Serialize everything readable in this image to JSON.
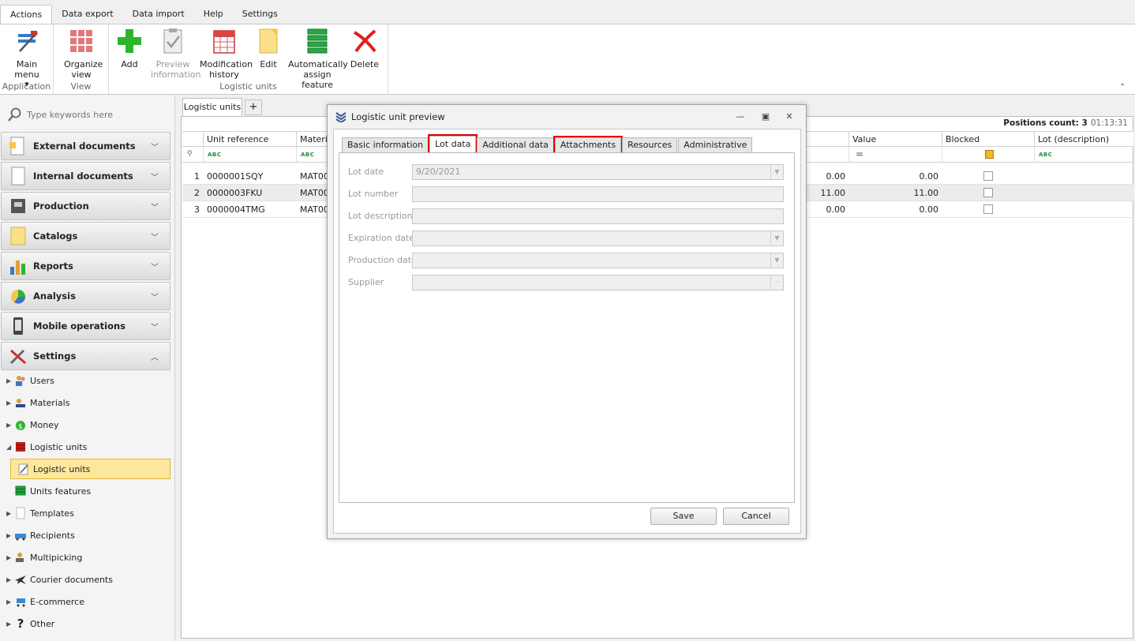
{
  "ribbon": {
    "tabs": [
      "Actions",
      "Data export",
      "Data import",
      "Help",
      "Settings"
    ],
    "groups": {
      "application": "Application",
      "view": "View",
      "logistic_units": "Logistic units"
    },
    "buttons": {
      "main_menu": "Main menu",
      "organize_view": "Organize view",
      "add": "Add",
      "preview_information": "Preview information",
      "modification_history": "Modification history",
      "edit": "Edit",
      "auto_assign": "Automatically assign feature",
      "delete": "Delete"
    }
  },
  "sidebar": {
    "search_placeholder": "Type keywords here",
    "sections": [
      "External documents",
      "Internal documents",
      "Production",
      "Catalogs",
      "Reports",
      "Analysis",
      "Mobile operations",
      "Settings"
    ],
    "settings_items": {
      "users": "Users",
      "materials": "Materials",
      "money": "Money",
      "logistic_units": "Logistic units",
      "logistic_units_child": "Logistic units",
      "units_features": "Units features",
      "templates": "Templates",
      "recipients": "Recipients",
      "multipicking": "Multipicking",
      "courier_documents": "Courier documents",
      "ecommerce": "E-commerce",
      "other": "Other"
    }
  },
  "document": {
    "tab_label": "Logistic units",
    "plus": "+",
    "positions_label": "Positions count: 3",
    "time": "01:13:31",
    "columns": {
      "unit_reference": "Unit reference",
      "material": "Materia",
      "value": "Value",
      "blocked": "Blocked",
      "lot_description": "Lot (description)"
    },
    "filter_equals": "=",
    "filter_abc": "ABC",
    "rows": [
      {
        "n": "1",
        "ref": "0000001SQY",
        "mat": "MAT000",
        "qty": "0.00",
        "value": "0.00"
      },
      {
        "n": "2",
        "ref": "0000003FKU",
        "mat": "MAT000",
        "qty": "11.00",
        "value": "11.00"
      },
      {
        "n": "3",
        "ref": "0000004TMG",
        "mat": "MAT000",
        "qty": "0.00",
        "value": "0.00"
      }
    ]
  },
  "modal": {
    "title": "Logistic unit preview",
    "tabs": [
      "Basic information",
      "Lot data",
      "Additional data",
      "Attachments",
      "Resources",
      "Administrative"
    ],
    "fields": {
      "lot_date_label": "Lot date",
      "lot_date_value": "9/20/2021",
      "lot_number_label": "Lot number",
      "lot_description_label": "Lot description",
      "expiration_date_label": "Expiration date",
      "production_date_label": "Production date",
      "supplier_label": "Supplier",
      "ellipsis": "···"
    },
    "save": "Save",
    "cancel": "Cancel"
  },
  "colors": {
    "highlight": "#e00000",
    "selected_item": "#fde79c",
    "accent_green": "#1a8f3a"
  }
}
